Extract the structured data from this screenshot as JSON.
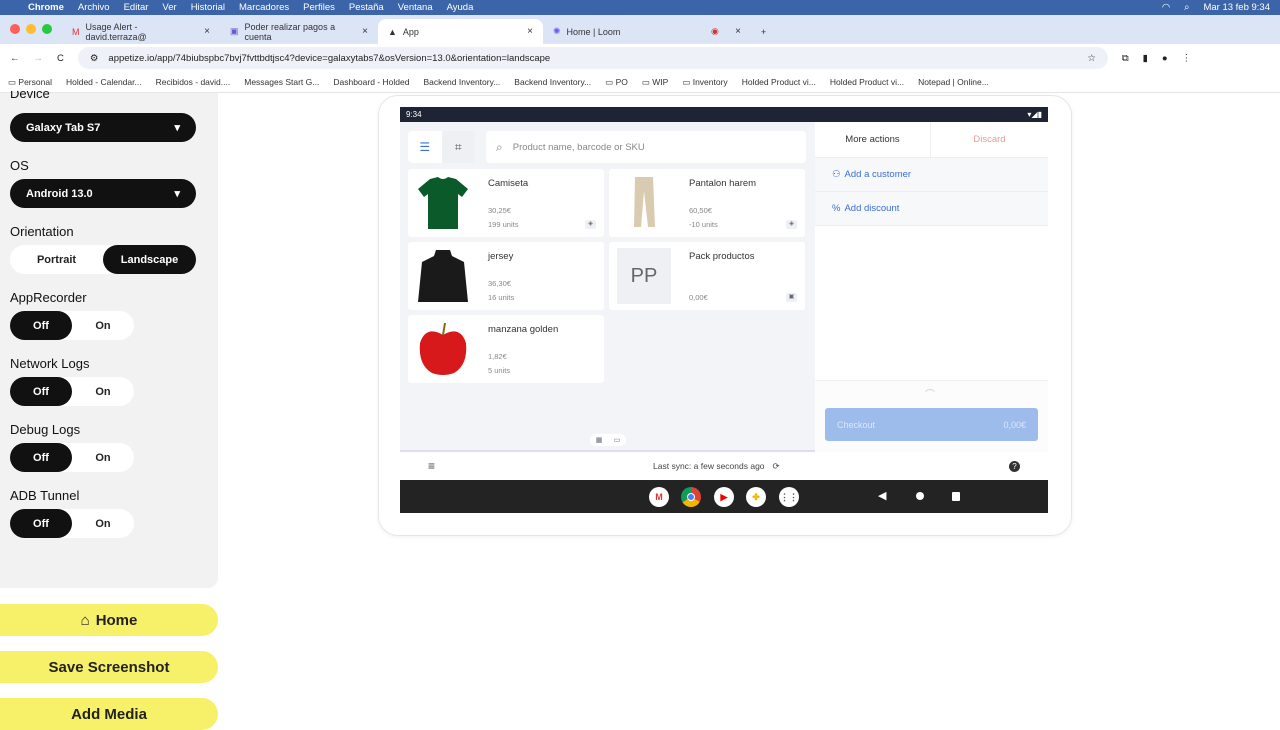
{
  "menubar": {
    "apple": "",
    "app": "Chrome",
    "items": [
      "Archivo",
      "Editar",
      "Ver",
      "Historial",
      "Marcadores",
      "Perfiles",
      "Pestaña",
      "Ventana",
      "Ayuda"
    ],
    "clock": "Mar 13 feb 9:34"
  },
  "tabs": [
    {
      "title": "Usage Alert - david.terraza@"
    },
    {
      "title": "Poder realizar pagos a cuenta"
    },
    {
      "title": "App"
    },
    {
      "title": "Home | Loom"
    }
  ],
  "url": "appetize.io/app/74biubspbc7bvj7fvttbdtjsc4?device=galaxytabs7&osVersion=13.0&orientation=landscape",
  "bookmarks": [
    "Personal",
    "Holded - Calendar...",
    "Recibidos - david....",
    "Messages Start G...",
    "Dashboard - Holded",
    "Backend Inventory...",
    "Backend Inventory...",
    "PO",
    "WIP",
    "Inventory",
    "Holded Product vi...",
    "Holded Product vi...",
    "Notepad | Online..."
  ],
  "sidebar": {
    "device_label": "Device",
    "device": "Galaxy Tab S7",
    "os_label": "OS",
    "os": "Android 13.0",
    "orientation_label": "Orientation",
    "portrait": "Portrait",
    "landscape": "Landscape",
    "orientation_selected": "Landscape",
    "toggles": [
      {
        "label": "AppRecorder",
        "off": "Off",
        "on": "On",
        "value": "Off"
      },
      {
        "label": "Network Logs",
        "off": "Off",
        "on": "On",
        "value": "Off"
      },
      {
        "label": "Debug Logs",
        "off": "Off",
        "on": "On",
        "value": "Off"
      },
      {
        "label": "ADB Tunnel",
        "off": "Off",
        "on": "On",
        "value": "Off"
      }
    ],
    "home": "Home",
    "save": "Save Screenshot",
    "media": "Add Media"
  },
  "device": {
    "time": "9:34",
    "search_placeholder": "Product name, barcode or SKU",
    "products": [
      {
        "name": "Camiseta",
        "price": "30,25€",
        "units": "199 units",
        "image": "green-tshirt"
      },
      {
        "name": "Pantalon harem",
        "price": "60,50€",
        "units": "-10 units",
        "image": "beige-pants"
      },
      {
        "name": "jersey",
        "price": "36,30€",
        "units": "16 units",
        "image": "black-hoodie"
      },
      {
        "name": "Pack productos",
        "price": "0,00€",
        "initials": "PP"
      },
      {
        "name": "manzana golden",
        "price": "1,82€",
        "units": "5 units",
        "image": "red-apple"
      }
    ],
    "more_actions": "More actions",
    "discard": "Discard",
    "add_customer": "Add a customer",
    "add_discount": "Add discount",
    "checkout": "Checkout",
    "checkout_total": "0,00€",
    "last_sync": "Last sync: a few seconds ago",
    "colors": {
      "accent": "#3b6fd1",
      "discard": "#e79a9a",
      "checkout": "#9dbcec"
    }
  }
}
